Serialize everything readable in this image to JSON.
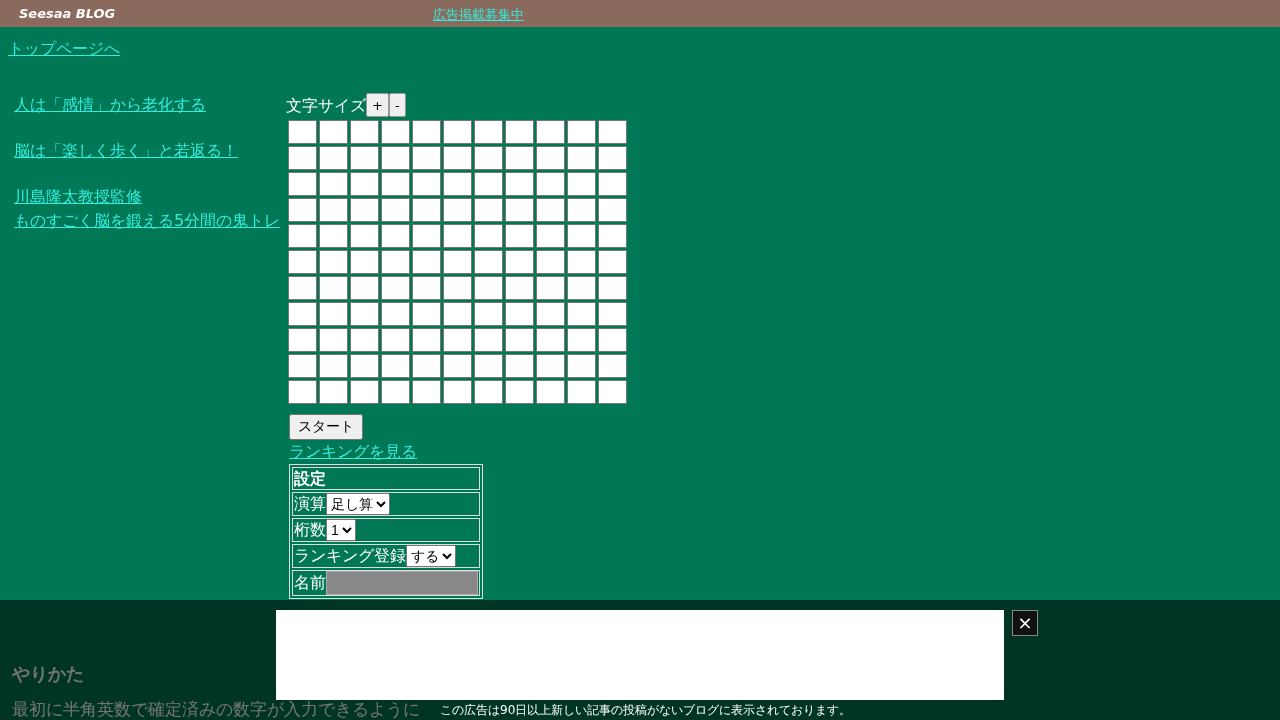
{
  "header": {
    "logo": "Seesaa BLOG",
    "ad_link": "広告掲載募集中"
  },
  "top_link": "トップページへ",
  "sidebar": {
    "links": [
      {
        "lines": [
          "人は「感情」から老化する"
        ]
      },
      {
        "lines": [
          "脳は「楽しく歩く」と若返る！"
        ]
      },
      {
        "lines": [
          "川島隆太教授監修",
          "ものすごく脳を鍛える5分間の鬼トレ"
        ]
      }
    ]
  },
  "font_size": {
    "label": "文字サイズ",
    "buttons": [
      "+",
      "-"
    ]
  },
  "start_button": "スタート",
  "ranking_link": "ランキングを見る",
  "settings": {
    "title": "設定",
    "rows": [
      {
        "kind": "select",
        "label": "演算",
        "value": "足し算"
      },
      {
        "kind": "select",
        "label": "桁数",
        "value": "1"
      },
      {
        "kind": "select",
        "label": "ランキング登録",
        "value": "する"
      },
      {
        "kind": "input",
        "label": "名前"
      }
    ]
  },
  "howto": {
    "heading": "やりかた",
    "text": "最初に半角英数で確定済みの数字が入力できるように"
  },
  "ad_overlay": {
    "notice": "この広告は90日以上新しい記事の投稿がないブログに表示されております。",
    "close": "×"
  }
}
